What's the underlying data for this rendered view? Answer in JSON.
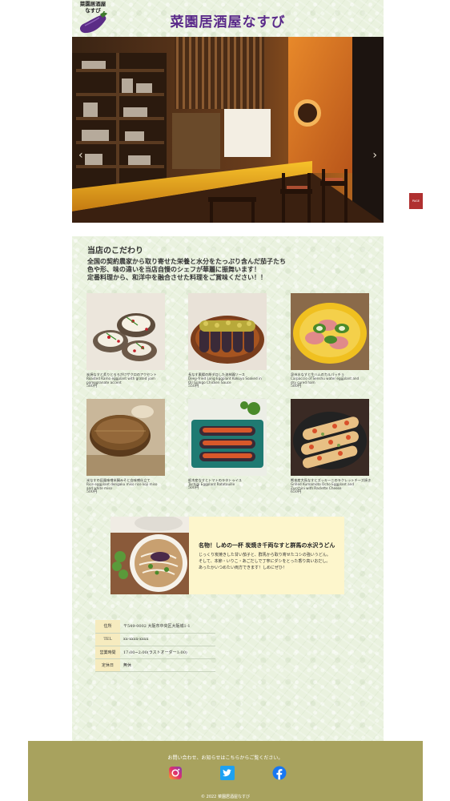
{
  "header": {
    "logo_text": "菜園居酒屋\nなすび",
    "site_title": "菜園居酒屋なすび"
  },
  "hero": {
    "prev_glyph": "‹",
    "next_glyph": "›",
    "page_top_label": "PAGE TOP"
  },
  "intro": {
    "title": "当店のこだわり",
    "lines": [
      "全国の契約農家から取り寄せた栄養と水分をたっぷり含んだ茄子たち",
      "色や形、味の違いを当店自慢のシェフが華麗に振舞います！",
      "定番料理から、和洋中を融合させた料理をご賞味ください！！"
    ]
  },
  "dishes": [
    {
      "jp": "炭焼なすと炙りとろろがけザクロのアクセント",
      "en1": "Roasted Kamo eggplant with grated yam",
      "en2": "pomegranate accent",
      "price": "580円"
    },
    {
      "jp": "長なす素揚の胡ダロした油林鶏ソース",
      "en1": "Deep-fried Long Eggplant Kokuyo Soaked in",
      "en2": "Oil Ginkgo Chicken Sauce",
      "price": "550円"
    },
    {
      "jp": "泉州水なすと生ハムのカルパッチョ",
      "en1": "Carpaccio of Senshu water eggplant and",
      "en2": "dry cured ham",
      "price": "580円"
    },
    {
      "jp": "米なすの田楽味噌米麹みそと白味噌仕立て",
      "en1": "Rice eggplant dengaku miso rice koji miso",
      "en2": "and white miso",
      "price": "500円"
    },
    {
      "jp": "栃木産なすとトマトのラタトゥイユ",
      "en1": "Tochigi Eggplant Ratatouille",
      "en2": "",
      "price": "500円"
    },
    {
      "jp": "熊本産大長なすとズッキーニのラクレットチーズ焼き",
      "en1": "Grilled Kumamoto Ocho Eggplant and",
      "en2": "Zucchini with Raclette Cheese",
      "price": "650円"
    }
  ],
  "feature": {
    "title": "名物！しめの一杯 炭焼き千両なすと群馬の水沢うどん",
    "lines": [
      "じっくり炭焼きした甘い茄子と、群馬から取り寄せたコシの強いうどん。",
      "そして、本節・いりこ・あごだしで丁寧にダシをとった香り高いおだし。",
      "あったかいつめたい両方できます！しめにぜひ！"
    ]
  },
  "info": [
    {
      "key": "住所",
      "value": "〒549-0002 大阪市中央区大阪城1-1"
    },
    {
      "key": "TEL",
      "value": "xx-xxxx-xxxx"
    },
    {
      "key": "営業時間",
      "value": "17:00~2:00(ラストオーダー1:00)"
    },
    {
      "key": "定休日",
      "value": "無休"
    }
  ],
  "footer": {
    "note": "お問い合わせ、お知らせはこちらからご覧ください。",
    "copyright": "© 2022 菜園居酒屋なすび"
  },
  "colors": {
    "title_purple": "#5a2a8a",
    "footer_olive": "#a8a25e",
    "feature_cream": "#fdf6cc",
    "info_key_bg": "#f6ebbf"
  },
  "icons": [
    "eggplant-logo-icon",
    "chevron-left-icon",
    "chevron-right-icon",
    "instagram-icon",
    "twitter-icon",
    "facebook-icon"
  ]
}
